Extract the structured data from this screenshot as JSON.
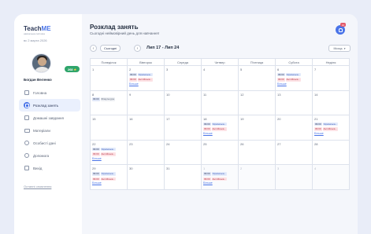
{
  "app": {
    "logo_main": "Teach",
    "logo_accent": "ME",
    "logo_sub": "навчальна система",
    "date": "вс 2 марта 2026"
  },
  "user": {
    "name": "Богдан Веленко",
    "points": "268"
  },
  "nav": [
    {
      "label": "Головна",
      "icon": "home-icon"
    },
    {
      "label": "Розклад занять",
      "icon": "calendar-icon",
      "active": true
    },
    {
      "label": "Домашні завдання",
      "icon": "homework-icon"
    },
    {
      "label": "Матеріали",
      "icon": "folder-icon"
    },
    {
      "label": "Особисті дані",
      "icon": "user-icon"
    },
    {
      "label": "Допомога",
      "icon": "help-icon"
    },
    {
      "label": "Вихід",
      "icon": "logout-icon"
    }
  ],
  "last_update": "Останні оновлення",
  "header": {
    "title": "Розклад занять",
    "subtitle": "Сьогодні неймовірний день для навчання!",
    "notifications": "10"
  },
  "toolbar": {
    "prev": "‹",
    "next": "›",
    "today": "Сьогодні",
    "range": "Лип 17 - Лип 24",
    "view": "Місяць"
  },
  "calendar": {
    "weekdays": [
      "Понеділок",
      "Вівторок",
      "Середа",
      "Четвер",
      "П'ятниця",
      "Субота",
      "Неділя"
    ],
    "weeks": [
      [
        {
          "day": "1",
          "events": [],
          "more": ""
        },
        {
          "day": "2",
          "events": [
            {
              "time": "09:00",
              "name": "Українська...",
              "color": "blue"
            },
            {
              "time": "09:00",
              "name": "Англійська...",
              "color": "red"
            }
          ],
          "more": "Більше"
        },
        {
          "day": "3",
          "events": [],
          "more": ""
        },
        {
          "day": "4",
          "events": [],
          "more": ""
        },
        {
          "day": "5",
          "events": [],
          "more": ""
        },
        {
          "day": "6",
          "events": [
            {
              "time": "09:00",
              "name": "Українська...",
              "color": "blue"
            },
            {
              "time": "09:00",
              "name": "Англійська...",
              "color": "red"
            }
          ],
          "more": "Більше"
        },
        {
          "day": "7",
          "events": [],
          "more": ""
        }
      ],
      [
        {
          "day": "8",
          "events": [
            {
              "time": "09:00",
              "name": "Фізкультура",
              "color": "gray"
            }
          ],
          "more": ""
        },
        {
          "day": "9",
          "events": [],
          "more": ""
        },
        {
          "day": "10",
          "events": [],
          "more": ""
        },
        {
          "day": "11",
          "events": [],
          "more": ""
        },
        {
          "day": "12",
          "events": [],
          "more": ""
        },
        {
          "day": "13",
          "events": [],
          "more": ""
        },
        {
          "day": "14",
          "events": [],
          "more": ""
        }
      ],
      [
        {
          "day": "15",
          "events": [],
          "more": ""
        },
        {
          "day": "16",
          "events": [],
          "more": ""
        },
        {
          "day": "17",
          "events": [],
          "more": ""
        },
        {
          "day": "18",
          "events": [
            {
              "time": "09:00",
              "name": "Українська...",
              "color": "blue"
            },
            {
              "time": "09:00",
              "name": "Англійська...",
              "color": "red"
            }
          ],
          "more": "Більше"
        },
        {
          "day": "19",
          "events": [],
          "more": ""
        },
        {
          "day": "20",
          "events": [],
          "more": ""
        },
        {
          "day": "21",
          "events": [
            {
              "time": "09:00",
              "name": "Українська...",
              "color": "blue"
            },
            {
              "time": "09:00",
              "name": "Англійська...",
              "color": "red"
            }
          ],
          "more": "Більше"
        }
      ],
      [
        {
          "day": "22",
          "events": [
            {
              "time": "09:00",
              "name": "Українська...",
              "color": "blue"
            },
            {
              "time": "09:00",
              "name": "Англійська...",
              "color": "red"
            }
          ],
          "more": "Більше"
        },
        {
          "day": "23",
          "events": [],
          "more": ""
        },
        {
          "day": "24",
          "events": [],
          "more": ""
        },
        {
          "day": "25",
          "events": [],
          "more": ""
        },
        {
          "day": "26",
          "events": [],
          "more": ""
        },
        {
          "day": "27",
          "events": [],
          "more": ""
        },
        {
          "day": "28",
          "events": [],
          "more": ""
        }
      ],
      [
        {
          "day": "29",
          "events": [
            {
              "time": "09:00",
              "name": "Українська...",
              "color": "blue"
            },
            {
              "time": "09:00",
              "name": "Англійська...",
              "color": "red"
            }
          ],
          "more": "Більше"
        },
        {
          "day": "30",
          "events": [],
          "more": ""
        },
        {
          "day": "31",
          "events": [],
          "more": ""
        },
        {
          "day": "1",
          "events": [
            {
              "time": "09:00",
              "name": "Українська...",
              "color": "blue"
            },
            {
              "time": "09:00",
              "name": "Англійська...",
              "color": "red"
            }
          ],
          "more": "Більше",
          "other": true
        },
        {
          "day": "2",
          "events": [],
          "more": "",
          "other": true
        },
        {
          "day": "3",
          "events": [],
          "more": "",
          "other": true
        },
        {
          "day": "4",
          "events": [],
          "more": "",
          "other": true
        }
      ]
    ]
  },
  "colors": {
    "accent": "#4a74e8",
    "points_badge": "#2fa56b",
    "notification_badge": "#e25a6a"
  }
}
